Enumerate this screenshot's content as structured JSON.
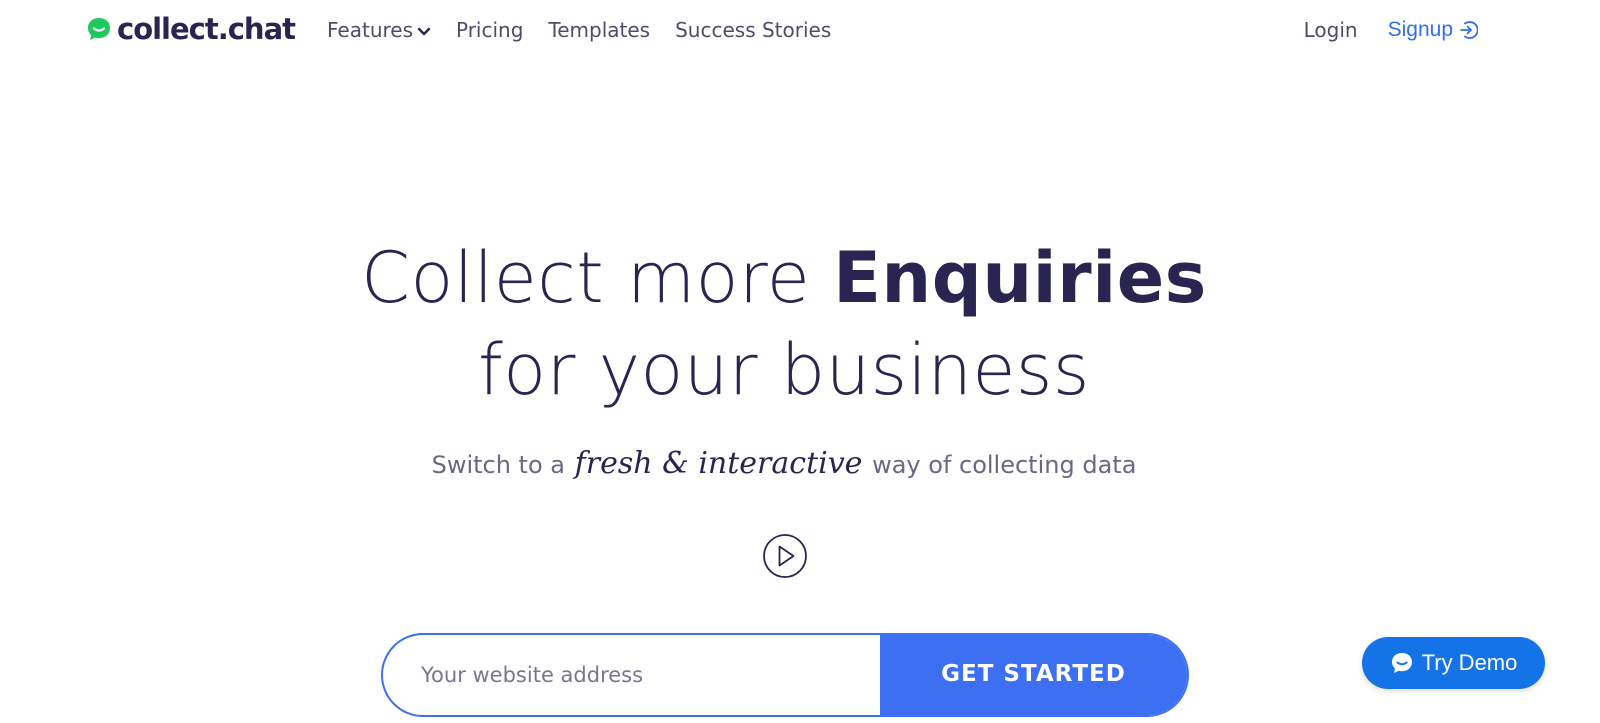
{
  "brand": {
    "name": "collect.chat",
    "icon": "chat-bubble-logo-icon",
    "icon_color": "#1ec95b",
    "text_color": "#2a2550"
  },
  "nav": {
    "items": [
      {
        "label": "Features",
        "icon": "chevron-down-icon"
      },
      {
        "label": "Pricing"
      },
      {
        "label": "Templates"
      },
      {
        "label": "Success Stories"
      }
    ],
    "login_label": "Login",
    "signup_label": "Signup",
    "signup_icon": "sign-in-arrow-icon"
  },
  "hero": {
    "title_light": "Collect more",
    "title_bold": "Enquiries",
    "title_line2": "for your business",
    "subtitle_prefix": "Switch to a",
    "subtitle_script": "fresh & interactive",
    "subtitle_suffix": "way of collecting data",
    "play_icon": "play-circle-icon"
  },
  "form": {
    "website_placeholder": "Your website address",
    "website_value": "",
    "cta_label": "GET STARTED"
  },
  "demo": {
    "label": "Try Demo",
    "icon": "chat-bubble-icon"
  },
  "colors": {
    "accent": "#3c6ff2",
    "link": "#2f6ff0",
    "demo_button": "#1473e6",
    "heading": "#2a2550",
    "nav_text": "#4f4b6b"
  }
}
